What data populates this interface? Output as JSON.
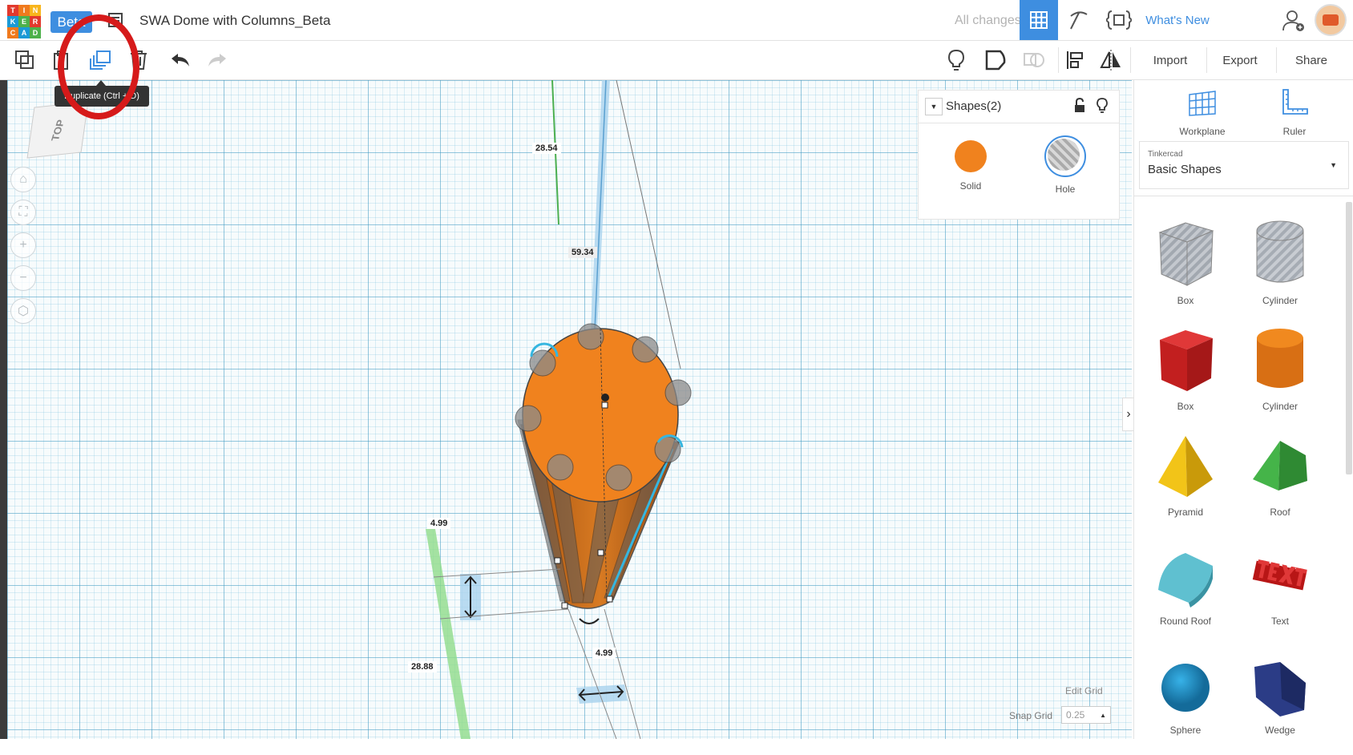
{
  "header": {
    "logo_letters": [
      "T",
      "I",
      "N",
      "K",
      "E",
      "R",
      "C",
      "A",
      "D"
    ],
    "logo_colors": [
      "#e2392d",
      "#f07a1d",
      "#f8b51c",
      "#1b9ad6",
      "#4db14b",
      "#e2392d",
      "#f07a1d",
      "#1b9ad6",
      "#4db14b"
    ],
    "beta_label": "Beta",
    "title": "SWA Dome with Columns_Beta",
    "saved_status": "All changes saved",
    "whats_new": "What's New"
  },
  "toolbar": {
    "import_label": "Import",
    "export_label": "Export",
    "share_label": "Share",
    "tooltip": "Duplicate (Ctrl + D)"
  },
  "viewcube": {
    "label": "TOP"
  },
  "shapes_panel": {
    "title": "Shapes(2)",
    "solid_label": "Solid",
    "hole_label": "Hole",
    "solid_color": "#f0821e"
  },
  "dimensions": {
    "top_height": "28.54",
    "diameter": "59.34",
    "elev_left": "4.99",
    "width_bottom": "4.99",
    "length_left": "28.88"
  },
  "grid": {
    "edit_grid": "Edit Grid",
    "snap_grid_label": "Snap Grid",
    "snap_grid_value": "0.25"
  },
  "right_panel": {
    "workplane_label": "Workplane",
    "ruler_label": "Ruler",
    "library_source": "Tinkercad",
    "library_name": "Basic Shapes",
    "shapes": [
      {
        "label": "Box"
      },
      {
        "label": "Cylinder"
      },
      {
        "label": "Box"
      },
      {
        "label": "Cylinder"
      },
      {
        "label": "Pyramid"
      },
      {
        "label": "Roof"
      },
      {
        "label": "Round Roof"
      },
      {
        "label": "Text"
      },
      {
        "label": "Sphere"
      },
      {
        "label": "Wedge"
      }
    ]
  }
}
